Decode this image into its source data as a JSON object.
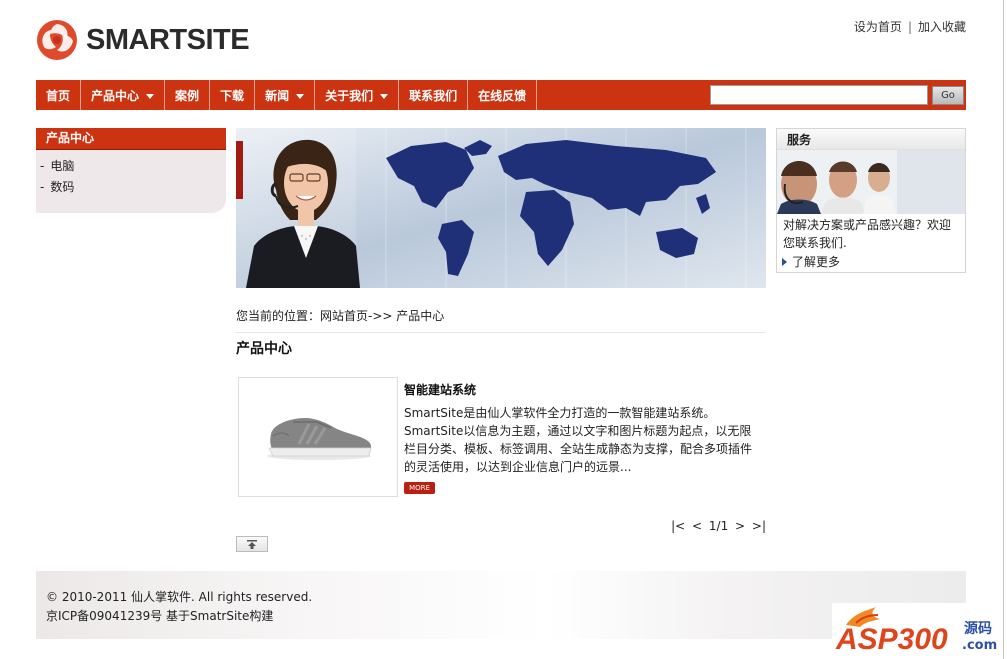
{
  "header": {
    "logo_text": "SMARTSITE",
    "links": [
      "设为首页",
      "加入收藏"
    ],
    "separator": "|"
  },
  "nav": {
    "items": [
      {
        "label": "首页",
        "dropdown": false
      },
      {
        "label": "产品中心",
        "dropdown": true
      },
      {
        "label": "案例",
        "dropdown": false
      },
      {
        "label": "下载",
        "dropdown": false
      },
      {
        "label": "新闻",
        "dropdown": true
      },
      {
        "label": "关于我们",
        "dropdown": true
      },
      {
        "label": "联系我们",
        "dropdown": false
      },
      {
        "label": "在线反馈",
        "dropdown": false
      }
    ],
    "search_value": "",
    "go_label": "Go"
  },
  "sidebar": {
    "title": "产品中心",
    "items": [
      {
        "dash": "-",
        "label": "电脑"
      },
      {
        "dash": "-",
        "label": "数码"
      }
    ]
  },
  "service": {
    "title": "服务",
    "text": "对解决方案或产品感兴趣？欢迎您联系我们.",
    "more": "了解更多"
  },
  "main": {
    "breadcrumb": "您当前的位置：网站首页->> 产品中心",
    "title": "产品中心",
    "product": {
      "name": "智能建站系统",
      "desc": "SmartSite是由仙人掌软件全力打造的一款智能建站系统。SmartSite以信息为主题，通过以文字和图片标题为起点，以无限栏目分类、模板、标签调用、全站生成静态为支撑，配合多项插件的灵活使用，以达到企业信息门户的远景...",
      "more": "MORE"
    },
    "pager": "|<  <  1/1  >  >|"
  },
  "footer": {
    "copyright": "© 2010-2011 仙人掌软件. All rights reserved.",
    "icp": "京ICP备09041239号  基于SmatrSite构建"
  },
  "watermark": {
    "text": "ASP300",
    "suffix": "源码",
    "domain": ".com"
  },
  "colors": {
    "nav_red": "#cc3311",
    "banner_blue": "#1e2f78",
    "more_red": "#bb1e12"
  }
}
